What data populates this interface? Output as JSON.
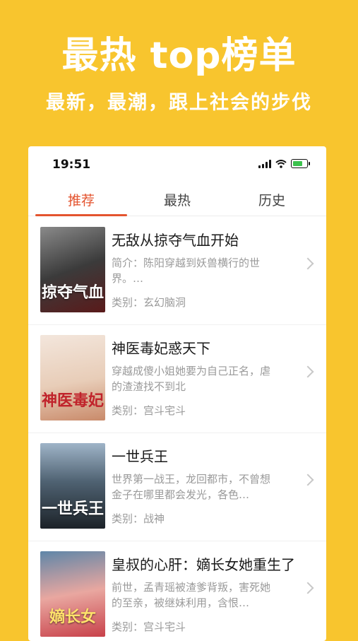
{
  "promo": {
    "title": "最热 top榜单",
    "subtitle": "最新，最潮，跟上社会的步伐"
  },
  "status_bar": {
    "time": "19:51",
    "battery_color": "#3CC24E"
  },
  "tabs": [
    {
      "label": "推荐",
      "active": true
    },
    {
      "label": "最热",
      "active": false
    },
    {
      "label": "历史",
      "active": false
    }
  ],
  "accent_color": "#E4542F",
  "background_color": "#F8C52E",
  "books": [
    {
      "title": "无敌从掠夺气血开始",
      "description": "简介：陈阳穿越到妖兽横行的世界。…",
      "category": "类别：玄幻脑洞",
      "cover_text": "掠夺气血"
    },
    {
      "title": "神医毒妃惑天下",
      "description": "穿越成傻小姐她要为自己正名，虐的渣渣找不到北",
      "category": "类别：宫斗宅斗",
      "cover_text": "神医毒妃"
    },
    {
      "title": "一世兵王",
      "description": "世界第一战王，龙回都市，不曾想金子在哪里都会发光，各色…",
      "category": "类别：战神",
      "cover_text": "一世兵王"
    },
    {
      "title": "皇叔的心肝：嫡长女她重生了",
      "description": "前世，孟青瑶被渣爹背叛，害死她的至亲，被继妹利用，含恨…",
      "category": "类别：宫斗宅斗",
      "cover_text": "嫡长女"
    }
  ]
}
